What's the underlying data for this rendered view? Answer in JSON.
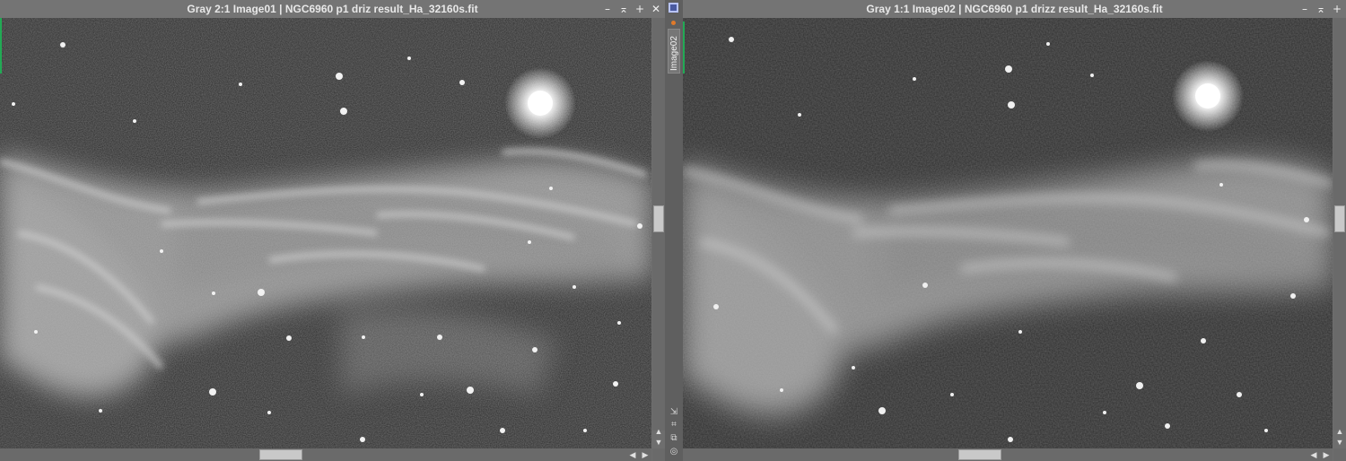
{
  "windows": {
    "left": {
      "title": "Gray 2:1 Image01 | NGC6960 p1 driz result_Ha_32160s.fit",
      "buttons": [
        "–",
        "⌅",
        "+",
        "✕"
      ]
    },
    "right": {
      "title": "Gray 1:1 Image02 | NGC6960 p1 drizz result_Ha_32160s.fit",
      "buttons": [
        "–",
        "⌅",
        "+"
      ]
    }
  },
  "side_strip": {
    "tab_label": "Image02",
    "tools": [
      "⇲",
      "⌗",
      "⧉",
      "◎"
    ]
  },
  "scroll": {
    "left": {
      "vertical_fraction": 0.49,
      "horizontal_fraction": 0.45
    },
    "right": {
      "vertical_fraction": 0.49,
      "horizontal_fraction": 0.48
    }
  },
  "icons": {
    "minimize": "minimize-icon",
    "shade": "shade-icon",
    "maximize": "maximize-icon",
    "close": "close-icon"
  },
  "colors": {
    "background": "#6e6e6e",
    "sky": "#2a2a2a",
    "nebula": "#bdbdbd",
    "accent_green": "#22aa55",
    "accent_orange": "#e07a2a"
  }
}
